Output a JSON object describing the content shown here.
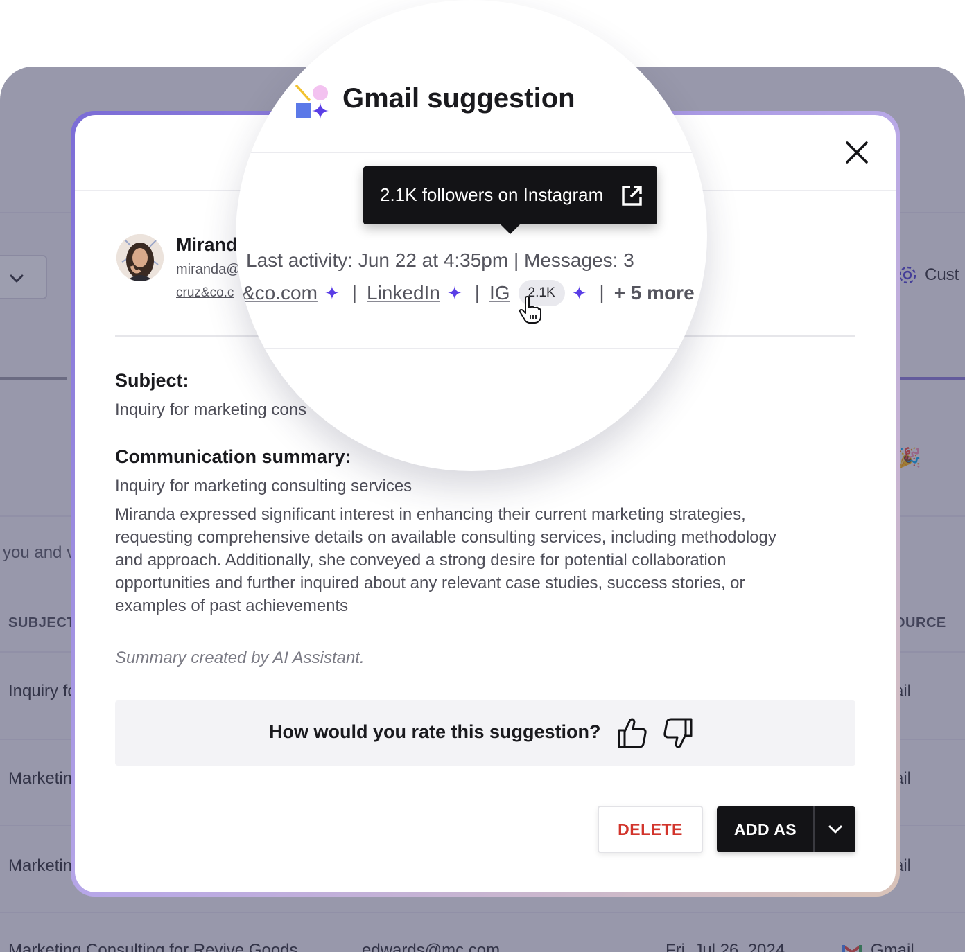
{
  "background": {
    "you_and_partial": "you and v",
    "subject_header": "SUBJECT",
    "source_header": "OURCE",
    "customize_partial": "Cust",
    "rows": [
      {
        "subject": "Inquiry fc",
        "source": "ail"
      },
      {
        "subject": "Marketin",
        "source": "ail"
      },
      {
        "subject": "Marketin",
        "source": "ail"
      }
    ],
    "last_row": {
      "subject": "Marketing Consulting for Revive Goods",
      "email": "edwards@mc.com",
      "date": "Fri, Jul 26, 2024",
      "source": "Gmail"
    },
    "party_icon": "party-popper-icon"
  },
  "lens": {
    "title": "Gmail suggestion",
    "name_partial": "Mirand",
    "email_partial": "miranda@",
    "last_activity": "Last activity: Jun 22 at 4:35pm | Messages: 3",
    "domain_link": "&co.com",
    "linkedin_link": "LinkedIn",
    "ig_link": "IG",
    "ig_count": "2.1K",
    "more_link": "+ 5 more",
    "tooltip": "2.1K followers on Instagram"
  },
  "contact": {
    "email_line2": "cruz&co.c"
  },
  "subject_label": "Subject:",
  "subject_value": "Inquiry for marketing cons",
  "summary_label": "Communication summary:",
  "summary_title": "Inquiry for marketing consulting services",
  "summary_body": "Miranda expressed significant interest in enhancing their current marketing strategies, requesting comprehensive details on available consulting services, including methodology and approach. Additionally, she conveyed a strong desire for potential collaboration opportunities and further inquired about any relevant case studies, success stories, or examples of past achievements",
  "ai_note": "Summary created by AI Assistant.",
  "rating_question": "How would you rate this suggestion?",
  "buttons": {
    "delete": "DELETE",
    "add_as": "ADD AS"
  },
  "colors": {
    "sparkle": "#5a3ee6",
    "delete_text": "#d2342b",
    "primary_button": "#131316"
  }
}
